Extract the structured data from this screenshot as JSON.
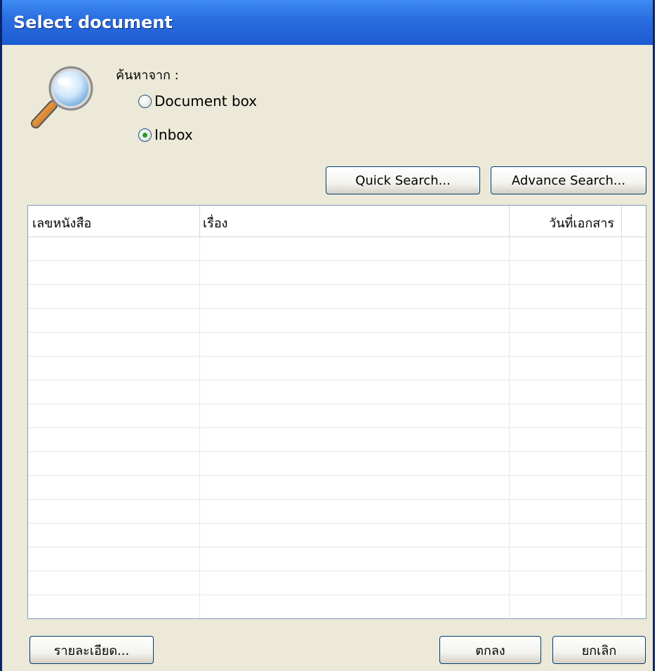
{
  "window": {
    "title": "Select document"
  },
  "search": {
    "from_label": "ค้นหาจาก :",
    "options": [
      {
        "label": "Document box",
        "checked": false
      },
      {
        "label": "Inbox",
        "checked": true
      }
    ],
    "quick_search_label": "Quick Search...",
    "advance_search_label": "Advance Search..."
  },
  "table": {
    "columns": [
      "เลขหนังสือ",
      "เรื่อง",
      "วันที่เอกสาร",
      ""
    ],
    "rows": []
  },
  "footer": {
    "details_label": "รายละเอียด...",
    "ok_label": "ตกลง",
    "cancel_label": "ยกเลิก"
  },
  "colors": {
    "titlebar": "#2b6fe0",
    "dialog_bg": "#ece9d8",
    "selected_radio": "#21a121"
  },
  "icons": {
    "search": "magnifier-icon"
  }
}
